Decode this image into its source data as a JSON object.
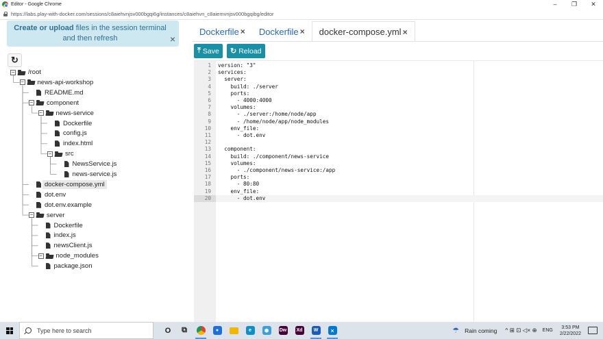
{
  "browser": {
    "window_title": "Editor - Google Chrome",
    "url": "https://labs.play-with-docker.com/sessions/c8aiehvnjsv000bgqi6g/instances/c8aiehvn_c8aiemvnjsv000bgqibg/editor",
    "minimize": "–",
    "maximize": "❐",
    "close": "✕"
  },
  "notice": {
    "bold": "Create or upload",
    "rest": " files in the session terminal and then refresh",
    "close": "×"
  },
  "refresh_icon": "↻",
  "tree": [
    {
      "label": "/root",
      "kind": "folder",
      "depth": 0,
      "toggle": "−"
    },
    {
      "label": "news-api-workshop",
      "kind": "folder",
      "depth": 1,
      "toggle": "−"
    },
    {
      "label": "README.md",
      "kind": "file",
      "depth": 2
    },
    {
      "label": "component",
      "kind": "folder",
      "depth": 2,
      "toggle": "−"
    },
    {
      "label": "news-service",
      "kind": "folder",
      "depth": 3,
      "toggle": "−"
    },
    {
      "label": "Dockerfile",
      "kind": "file",
      "depth": 4
    },
    {
      "label": "config.js",
      "kind": "file",
      "depth": 4
    },
    {
      "label": "index.html",
      "kind": "file",
      "depth": 4
    },
    {
      "label": "src",
      "kind": "folder",
      "depth": 4,
      "toggle": "−"
    },
    {
      "label": "NewsService.js",
      "kind": "file",
      "depth": 5
    },
    {
      "label": "news-service.js",
      "kind": "file",
      "depth": 5
    },
    {
      "label": "docker-compose.yml",
      "kind": "file",
      "depth": 2,
      "selected": true
    },
    {
      "label": "dot.env",
      "kind": "file",
      "depth": 2
    },
    {
      "label": "dot.env.example",
      "kind": "file",
      "depth": 2
    },
    {
      "label": "server",
      "kind": "folder",
      "depth": 2,
      "toggle": "−"
    },
    {
      "label": "Dockerfile",
      "kind": "file",
      "depth": 3
    },
    {
      "label": "index.js",
      "kind": "file",
      "depth": 3
    },
    {
      "label": "newsClient.js",
      "kind": "file",
      "depth": 3
    },
    {
      "label": "node_modules",
      "kind": "folder",
      "depth": 3,
      "toggle": "−"
    },
    {
      "label": "package.json",
      "kind": "file",
      "depth": 3
    }
  ],
  "tabs": [
    {
      "label": "Dockerfile",
      "close": "×",
      "active": false
    },
    {
      "label": "Dockerfile",
      "close": "×",
      "active": false
    },
    {
      "label": "docker-compose.yml",
      "close": "×",
      "active": true
    }
  ],
  "toolbar": {
    "save_icon": "⤒",
    "save_label": "Save",
    "reload_icon": "↻",
    "reload_label": "Reload"
  },
  "editor": {
    "active_line": 20,
    "lines": [
      "version: \"3\"",
      "services:",
      "  server:",
      "    build: ./server",
      "    ports:",
      "      - 4000:4000",
      "    volumes:",
      "      - ./server:/home/node/app",
      "      - /home/node/app/node_modules",
      "    env_file:",
      "      - dot.env",
      "",
      "  component:",
      "    build: ./component/news-service",
      "    volumes:",
      "      - ./component/news-service:/app",
      "    ports:",
      "      - 80:80",
      "    env_file:",
      "      - dot.env"
    ]
  },
  "taskbar": {
    "search_placeholder": "Type here to search",
    "apps": [
      {
        "name": "cortana",
        "glyph": "O",
        "color": "#222222",
        "running": false
      },
      {
        "name": "task-view",
        "glyph": "⧉",
        "color": "#222222",
        "running": false
      },
      {
        "name": "chrome",
        "glyph": "",
        "color": "#db4437",
        "running": true
      },
      {
        "name": "app-blue",
        "glyph": "●",
        "color": "#1e6fd9",
        "running": false
      },
      {
        "name": "file-explorer",
        "glyph": "",
        "color": "#f2b500",
        "running": false
      },
      {
        "name": "edge",
        "glyph": "e",
        "color": "#0f8ec7",
        "running": false
      },
      {
        "name": "app-hex",
        "glyph": "⬢",
        "color": "#3aa0d8",
        "running": false
      },
      {
        "name": "dreamweaver",
        "glyph": "Dw",
        "color": "#470137",
        "running": false
      },
      {
        "name": "adobe-xd",
        "glyph": "Xd",
        "color": "#470137",
        "running": false
      },
      {
        "name": "word",
        "glyph": "W",
        "color": "#185abd",
        "running": true
      },
      {
        "name": "vscode",
        "glyph": "⨯",
        "color": "#0078d4",
        "running": true
      }
    ],
    "weather": "Rain coming",
    "tray_icons": "^  ⊞  ⊡  ◁×  ⊕",
    "lang": "ENG",
    "time": "3:53 PM",
    "date": "2/22/2022"
  }
}
